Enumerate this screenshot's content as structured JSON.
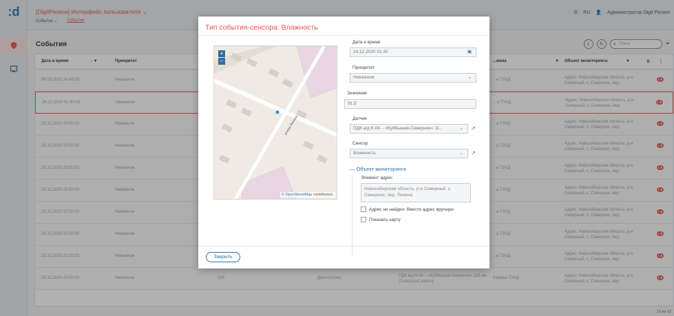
{
  "app": {
    "title": "[DigitРегион] Интерфейс пользователя",
    "brand_color": "#e8554e",
    "accent_color": "#2f6fa6"
  },
  "breadcrumbs": [
    "События",
    "События"
  ],
  "header_right": {
    "lang": "RU",
    "user": "Администратор Digit Регион"
  },
  "page": {
    "title": "События",
    "search_placeholder": "Поиск"
  },
  "table": {
    "columns": [
      "Дата и время",
      "Приоритет",
      "...мена",
      "Объект мониторинга"
    ],
    "rows": [
      {
        "date": "06.03.2021 16:48:53",
        "priority": "Неважное",
        "name": "...а ТУАД",
        "object": "Адрес: Новосибирская область, р-н Северный, с. Северное, пер."
      },
      {
        "date": "24.12.2020 01:30:03",
        "priority": "Неважное",
        "name": "...а ТУАД",
        "object": "Адрес: Новосибирская область, р-н Северный, с. Северное, пер."
      },
      {
        "date": "23.12.2020 23:50:02",
        "priority": "Неважное",
        "name": "...а ТУАД",
        "object": "Адрес: Новосибирская область, р-н Северный, с. Северное, пер."
      },
      {
        "date": "23.12.2020 23:50:02",
        "priority": "Неважное",
        "name": "...а ТУАД",
        "object": "Адрес: Новосибирская область, р-н Северный, с. Северное, пер."
      },
      {
        "date": "23.12.2020 23:50:02",
        "priority": "Неважное",
        "name": "...а ТУАД",
        "object": "Адрес: Новосибирская область, р-н Северный, с. Северное, пер."
      },
      {
        "date": "23.12.2020 22:50:02",
        "priority": "Неважное",
        "name": "...а ТУАД",
        "object": "Адрес: Новосибирская область, р-н Северный, с. Северное, пер."
      },
      {
        "date": "23.12.2020 22:20:02",
        "priority": "Неважное",
        "name": "...а ТУАД",
        "object": "Адрес: Новосибирская область, р-н Северный, с. Северное, пер."
      },
      {
        "date": "23.12.2020 22:20:02",
        "priority": "Неважное",
        "name": "...а ТУАД",
        "object": "Адрес: Новосибирская область, р-н Северный, с. Северное, пер."
      },
      {
        "date": "23.12.2020 22:20:02",
        "priority": "Неважное",
        "name": "...а ТУАД",
        "object": "Адрес: Новосибирская область, р-н Северный, с. Северное, пер."
      },
      {
        "date": "23.12.2020 22:00:02",
        "priority": "Неважное",
        "value": "100",
        "type": "Диагностика",
        "sensor": "ПДК а/д К-04 – «Куйбышев-Северное» 115 км (Северный район)",
        "name": "Камера ТУАД",
        "object": "Адрес: Новосибирская область, р-н Северный, с. Северное, пер."
      }
    ],
    "footer_count": "13 из 13"
  },
  "modal": {
    "title": "Тип события-сенсора: Влажность",
    "map_attribution_link": "© OpenStreetMap",
    "map_attribution_text": " contributors.",
    "street_label": "улица Ленина",
    "fields": {
      "datetime_label": "Дата и время",
      "datetime_value": "24.12.2020 01:30",
      "priority_label": "Приоритет",
      "priority_value": "Неважное",
      "value_label": "Значение",
      "value_value": "91.5",
      "sensor_device_label": "Датчик",
      "sensor_device_value": "ПДК а/д К-04 – «Куйбышев-Северное» 11...",
      "sensor_label": "Сенсор",
      "sensor_value": "Влажность"
    },
    "monitoring_section": "Объект мониторинга",
    "address_label": "Элемент адрес",
    "address_value": "Новосибирская область, р-н Северный, с. Северное, пер. Ленина",
    "checkbox_manual": "Адрес не найден. Ввести адрес вручную",
    "checkbox_map": "Показать карту",
    "close_label": "Закрыть"
  }
}
